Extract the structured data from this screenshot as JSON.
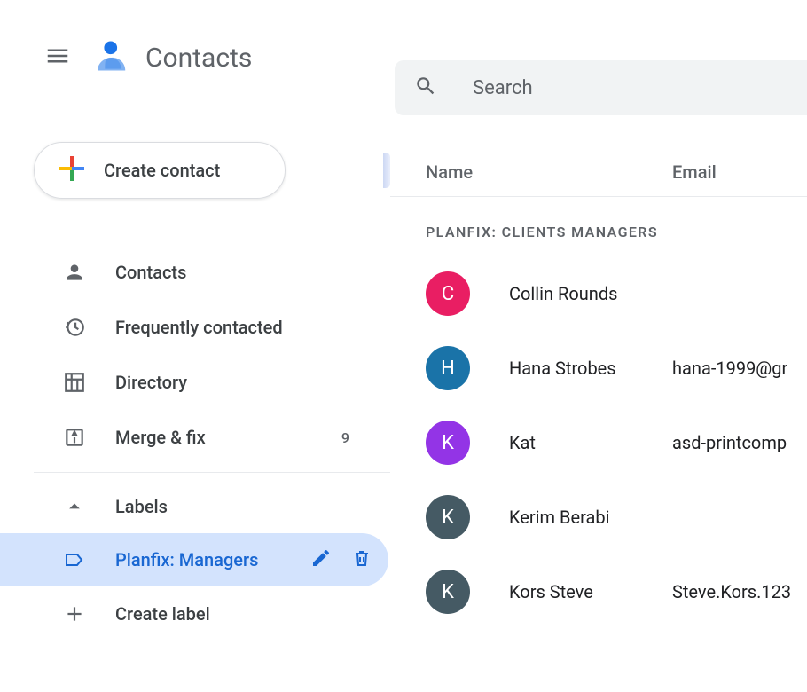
{
  "header": {
    "app_title": "Contacts",
    "search_placeholder": "Search"
  },
  "sidebar": {
    "create_label": "Create contact",
    "nav": [
      {
        "icon": "person",
        "label": "Contacts"
      },
      {
        "icon": "history",
        "label": "Frequently contacted"
      },
      {
        "icon": "domain",
        "label": "Directory"
      },
      {
        "icon": "merge",
        "label": "Merge & fix",
        "count": "9"
      }
    ],
    "labels_header": "Labels",
    "labels": [
      {
        "label": "Planfix: Managers",
        "selected": true
      }
    ],
    "create_label_text": "Create label"
  },
  "list": {
    "col_name": "Name",
    "col_email": "Email",
    "section_title": "PLANFIX: CLIENTS MANAGERS",
    "contacts": [
      {
        "initial": "C",
        "color": "#e91e63",
        "name": "Collin Rounds",
        "email": ""
      },
      {
        "initial": "H",
        "color": "#1a73a8",
        "name": "Hana Strobes",
        "email": "hana-1999@gr"
      },
      {
        "initial": "K",
        "color": "#9334e6",
        "name": "Kat",
        "email": "asd-printcomp"
      },
      {
        "initial": "K",
        "color": "#455a64",
        "name": "Kerim Berabi",
        "email": ""
      },
      {
        "initial": "K",
        "color": "#455a64",
        "name": "Kors Steve",
        "email": "Steve.Kors.123"
      }
    ]
  }
}
